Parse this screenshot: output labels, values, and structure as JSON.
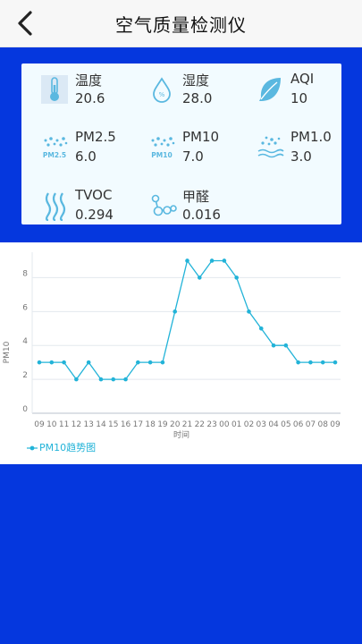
{
  "header": {
    "title": "空气质量检测仪"
  },
  "sensors": [
    {
      "label": "温度",
      "value": "20.6",
      "icon": "thermometer-icon"
    },
    {
      "label": "湿度",
      "value": "28.0",
      "icon": "water-drop-icon"
    },
    {
      "label": "AQI",
      "value": "10",
      "icon": "leaf-icon"
    },
    {
      "label": "PM2.5",
      "value": "6.0",
      "icon": "pm25-icon",
      "icon_text": "PM2.5"
    },
    {
      "label": "PM10",
      "value": "7.0",
      "icon": "pm10-icon",
      "icon_text": "PM10"
    },
    {
      "label": "PM1.0",
      "value": "3.0",
      "icon": "pm1-icon"
    },
    {
      "label": "TVOC",
      "value": "0.294",
      "icon": "wave-icon"
    },
    {
      "label": "甲醛",
      "value": "0.016",
      "icon": "molecule-icon"
    }
  ],
  "colors": {
    "accent": "#0537de",
    "line": "#22b3d8",
    "icon": "#5ab8e0"
  },
  "chart_data": {
    "type": "line",
    "x": [
      "09",
      "10",
      "11",
      "12",
      "13",
      "14",
      "15",
      "16",
      "17",
      "18",
      "19",
      "20",
      "21",
      "22",
      "23",
      "00",
      "01",
      "02",
      "03",
      "04",
      "05",
      "06",
      "07",
      "08",
      "09"
    ],
    "series": [
      {
        "name": "PM10趋势图",
        "values": [
          3,
          3,
          3,
          2,
          3,
          2,
          2,
          2,
          3,
          3,
          3,
          6,
          9,
          8,
          9,
          9,
          8,
          6,
          5,
          4,
          4,
          3,
          3,
          3,
          3
        ]
      }
    ],
    "xlabel": "时间",
    "ylabel": "PM10",
    "yticks": [
      0,
      2,
      4,
      6,
      8
    ],
    "ylim": [
      0,
      9.5
    ],
    "grid": true,
    "legend": "bottom-left"
  }
}
